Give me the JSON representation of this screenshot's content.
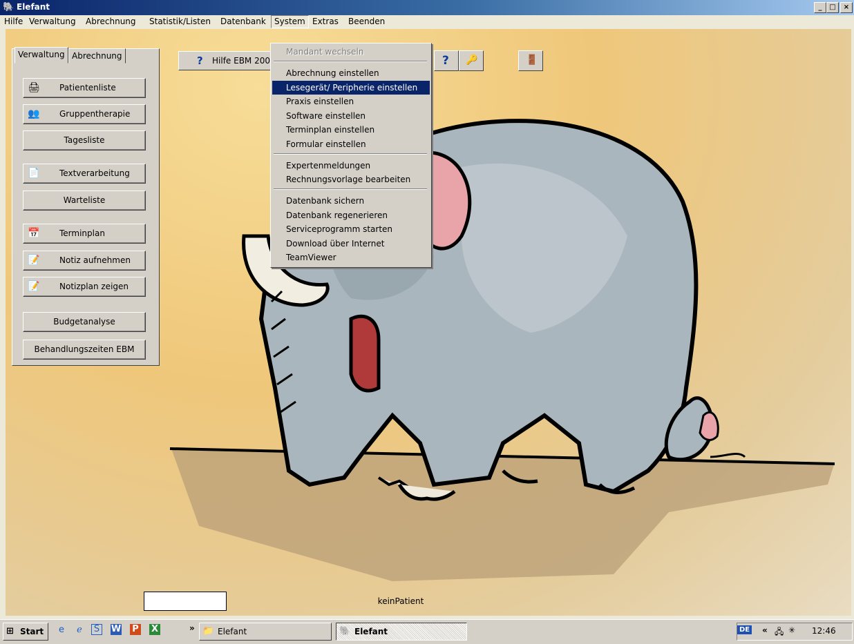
{
  "window": {
    "title": "Elefant",
    "icon": "elephant-icon",
    "controls": [
      "_",
      "□",
      "×"
    ]
  },
  "menubar": [
    "Hilfe",
    "Verwaltung",
    "Abrechnung",
    "Statistik/Listen",
    "Datenbank",
    "System",
    "Extras",
    "Beenden"
  ],
  "menubar_open_index": 5,
  "left_panel": {
    "tabs": [
      "Verwaltung",
      "Abrechnung"
    ],
    "active_tab": 0,
    "buttons": [
      {
        "label": "Patientenliste",
        "icon": "printer-icon"
      },
      {
        "label": "Gruppentherapie",
        "icon": "group-icon"
      },
      {
        "label": "Tagesliste",
        "icon": ""
      },
      {
        "label": "Textverarbeitung",
        "icon": "document-icon"
      },
      {
        "label": "Warteliste",
        "icon": ""
      },
      {
        "label": "Terminplan",
        "icon": "calendar-icon"
      },
      {
        "label": "Notiz aufnehmen",
        "icon": "notepad-icon"
      },
      {
        "label": "Notizplan zeigen",
        "icon": "notepad-icon"
      },
      {
        "label": "Budgetanalyse",
        "icon": ""
      },
      {
        "label": "Behandlungszeiten EBM",
        "icon": ""
      }
    ]
  },
  "toolbar": {
    "help_button_label": "Hilfe EBM 200",
    "icons": [
      "help-question-icon",
      "help-key-icon",
      "exit-door-icon"
    ]
  },
  "system_menu": {
    "groups": [
      [
        {
          "label": "Mandant wechseln",
          "disabled": true
        }
      ],
      [
        {
          "label": "Abrechnung einstellen"
        },
        {
          "label": "Lesegerät/ Peripherie einstellen",
          "highlighted": true
        },
        {
          "label": "Praxis einstellen"
        },
        {
          "label": "Software einstellen"
        },
        {
          "label": "Terminplan einstellen"
        },
        {
          "label": "Formular einstellen"
        }
      ],
      [
        {
          "label": "Expertenmeldungen"
        },
        {
          "label": "Rechnungsvorlage bearbeiten"
        }
      ],
      [
        {
          "label": "Datenbank sichern"
        },
        {
          "label": "Datenbank regenerieren"
        },
        {
          "label": "Serviceprogramm starten"
        },
        {
          "label": "Download über Internet"
        },
        {
          "label": "TeamViewer"
        }
      ]
    ]
  },
  "status": {
    "patient_label": "keinPatient",
    "patient_box": ""
  },
  "taskbar": {
    "start_label": "Start",
    "quicklaunch": [
      "ie-icon",
      "ie-icon",
      "app-icon",
      "word-icon",
      "powerpoint-icon",
      "excel-icon"
    ],
    "overflow": "»",
    "items": [
      {
        "label": "Elefant",
        "icon": "folder-icon",
        "pressed": false
      },
      {
        "label": "Elefant",
        "icon": "elephant-icon",
        "pressed": true
      }
    ],
    "tray": {
      "lang": "DE",
      "chevron": "«",
      "clock": "12:46"
    }
  }
}
